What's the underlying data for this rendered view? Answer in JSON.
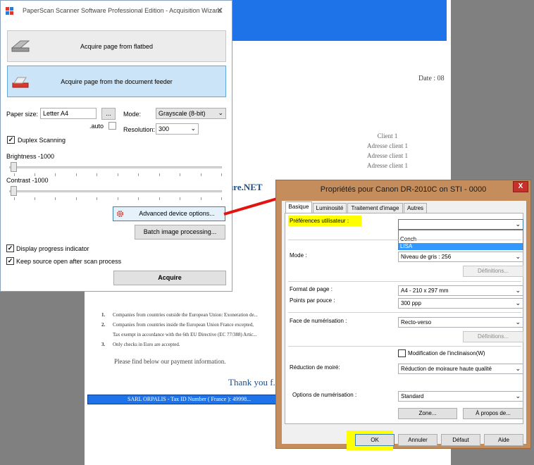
{
  "document": {
    "date_label": "Date : 08",
    "client_lines": [
      "Client 1",
      "Adresse client 1",
      "Adresse client 1",
      "Adresse client 1"
    ],
    "brand": "...ture.NET",
    "notes": [
      {
        "num": "1.",
        "text": "Companies from countries outside the European Union: Exoneration de..."
      },
      {
        "num": "2.",
        "text": "Companies from countries inside the European Union France excepted,"
      },
      {
        "num": "",
        "text": "Tax exempt in accordance with the 6th EU Directive (EC 77/388) Artic..."
      },
      {
        "num": "3.",
        "text": "Only checks in Euro are accepted."
      }
    ],
    "payment": "Please find below our payment information.",
    "thanks": "Thank you f...",
    "footer_bar": "SARL ORPALIS  - Tax ID Number ( France ): 49998..."
  },
  "paperscan": {
    "title": "PaperScan Scanner Software Professional Edition - Acquisition Wizard",
    "close": "✕",
    "flatbed_label": "Acquire page from flatbed",
    "feeder_label": "Acquire page from the document feeder",
    "paper_size_label": "Paper size:",
    "paper_size_value": "Letter A4",
    "paper_size_btn": "...",
    "mode_label": "Mode:",
    "mode_value": "Grayscale (8-bit)",
    "auto_label": ".auto",
    "resolution_label": "Resolution:",
    "resolution_value": "300",
    "duplex_label": "Duplex Scanning",
    "brightness_label": "Brightness -1000",
    "contrast_label": "Contrast -1000",
    "advanced_label": "Advanced device options...",
    "batch_label": "Batch image processing...",
    "progress_label": "Display progress indicator",
    "keep_source_label": "Keep source open after scan process",
    "acquire_label": "Acquire",
    "check_mark": "✓",
    "dropdown_arrow": "⌄",
    "colors": {
      "accent": "#cce4f7",
      "icon_red": "#d9382b"
    }
  },
  "canon": {
    "title": "Propriétés pour Canon DR-2010C on STI - 0000",
    "close": "X",
    "tabs": [
      "Basique",
      "Luminosité",
      "Traitement d'image",
      "Autres"
    ],
    "prefs_label": "Préférences utilisateur :",
    "prefs_value": "",
    "prefs_options": [
      "Conch",
      "LISA"
    ],
    "mode_label": "Mode :",
    "mode_value": "Niveau de gris : 256",
    "definitions": "Définitions...",
    "page_format_label": "Format de page :",
    "page_format_value": "A4 - 210 x 297 mm",
    "dpi_label": "Points par pouce :",
    "dpi_value": "300 ppp",
    "face_label": "Face de numérisation :",
    "face_value": "Recto-verso",
    "tilt_label": "Modification de l'inclinaison(W)",
    "moire_label": "Réduction de moiré:",
    "moire_value": "Réduction de moiraure haute qualité",
    "scan_opts_label": "Options de numérisation :",
    "scan_opts_value": "Standard",
    "zone_btn": "Zone...",
    "about_btn": "À propos de...",
    "ok_btn": "OK",
    "cancel_btn": "Annuler",
    "default_btn": "Défaut",
    "help_btn": "Aide",
    "dropdown_arrow": "⌄",
    "colors": {
      "frame": "#c58d5c",
      "highlight": "#ffff00",
      "close": "#c7312a",
      "list_highlight": "#3399ff"
    }
  },
  "annotation": {
    "arrow_color": "#e3130f"
  }
}
